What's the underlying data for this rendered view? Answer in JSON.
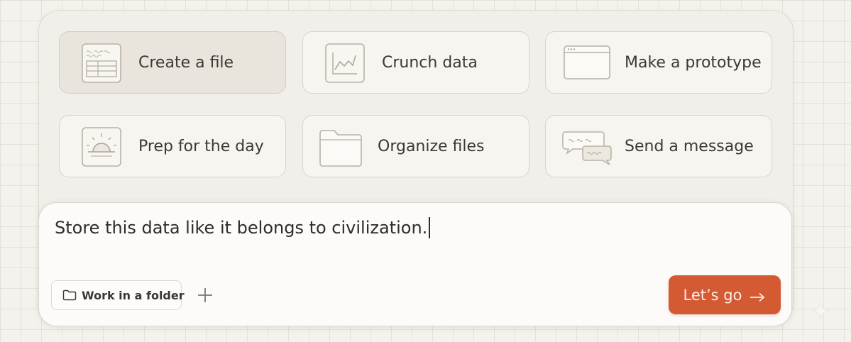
{
  "cards": [
    {
      "label": "Create a file",
      "icon": "spreadsheet-icon",
      "active": true
    },
    {
      "label": "Crunch data",
      "icon": "line-chart-icon",
      "active": false
    },
    {
      "label": "Make a prototype",
      "icon": "browser-window-icon",
      "active": false
    },
    {
      "label": "Prep for the day",
      "icon": "sunrise-icon",
      "active": false
    },
    {
      "label": "Organize files",
      "icon": "folder-icon",
      "active": false
    },
    {
      "label": "Send a message",
      "icon": "chat-bubbles-icon",
      "active": false
    }
  ],
  "composer": {
    "text": "Store this data like it belongs to civilization.",
    "folder_button_label": "Work in a folder",
    "add_button_icon": "plus-icon",
    "submit_label": "Let’s go",
    "submit_icon": "arrow-right-icon"
  },
  "colors": {
    "accent": "#d45a34",
    "background": "#f4f2ec",
    "card_active": "#e9e5dc"
  }
}
